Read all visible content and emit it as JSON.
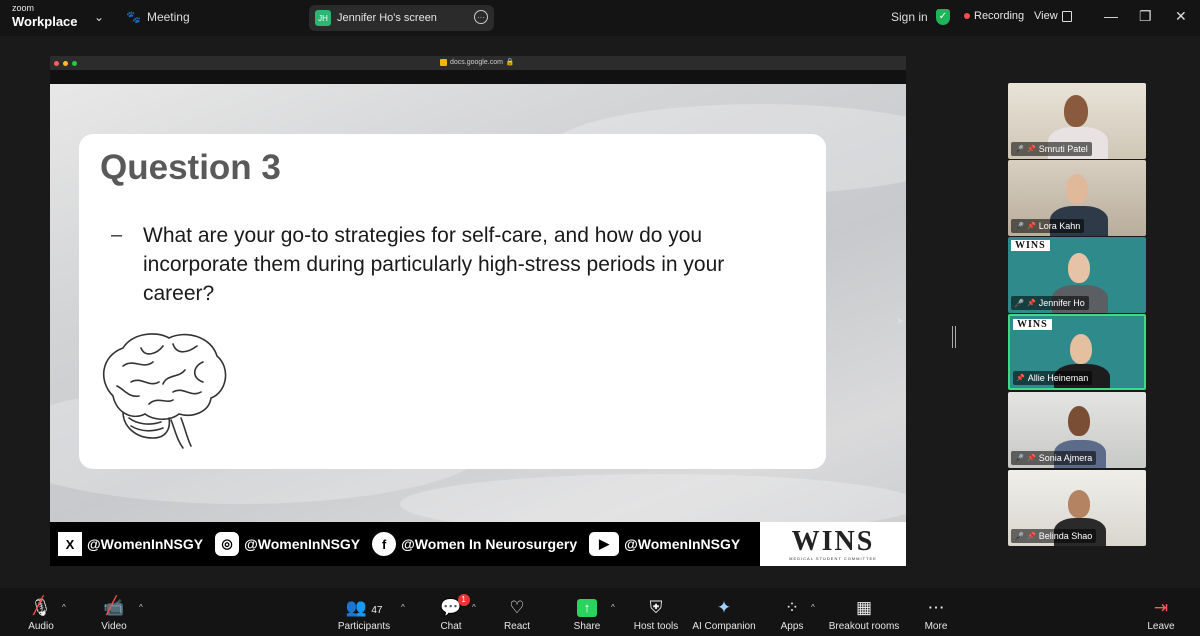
{
  "app": {
    "brand_top": "zoom",
    "brand_bottom": "Workplace",
    "meeting_label": "Meeting"
  },
  "share_pill": {
    "initials": "JH",
    "label": "Jennifer Ho's screen"
  },
  "top_right": {
    "signin": "Sign in",
    "recording": "Recording",
    "view": "View"
  },
  "browser": {
    "url": "docs.google.com"
  },
  "slide": {
    "title": "Question 3",
    "bullet": "–",
    "body": "What are your go-to strategies for self-care, and how do you incorporate them during particularly high-stress periods in your career?",
    "social": [
      {
        "icon": "x-icon",
        "glyph": "X",
        "handle": "@WomenInNSGY"
      },
      {
        "icon": "instagram-icon",
        "glyph": "◎",
        "handle": "@WomenInNSGY"
      },
      {
        "icon": "facebook-icon",
        "glyph": "f",
        "handle": "@Women In Neurosurgery"
      },
      {
        "icon": "youtube-icon",
        "glyph": "▶",
        "handle": "@WomenInNSGY"
      }
    ],
    "logo": "WINS",
    "logo_sub": "MEDICAL STUDENT COMMITTEE"
  },
  "participants": [
    {
      "name": "Smruti Patel",
      "muted": true
    },
    {
      "name": "Lora Kahn",
      "muted": true
    },
    {
      "name": "Jennifer Ho",
      "muted": true
    },
    {
      "name": "Allie Heineman",
      "muted": false,
      "active": true
    },
    {
      "name": "Sonia Ajmera",
      "muted": true
    },
    {
      "name": "Belinda Shao",
      "muted": true
    }
  ],
  "tile_logo": "WINS",
  "toolbar": {
    "audio": "Audio",
    "video": "Video",
    "participants": "Participants",
    "participant_count": "47",
    "chat": "Chat",
    "chat_badge": "1",
    "react": "React",
    "share": "Share",
    "host_tools": "Host tools",
    "ai_companion": "AI Companion",
    "apps": "Apps",
    "breakout": "Breakout rooms",
    "more": "More",
    "leave": "Leave"
  },
  "colors": {
    "active_border": "#3ddc84",
    "share_green": "#2bd35e",
    "recording_red": "#ff4d4d",
    "tile_teal": "#2f8a8c"
  }
}
